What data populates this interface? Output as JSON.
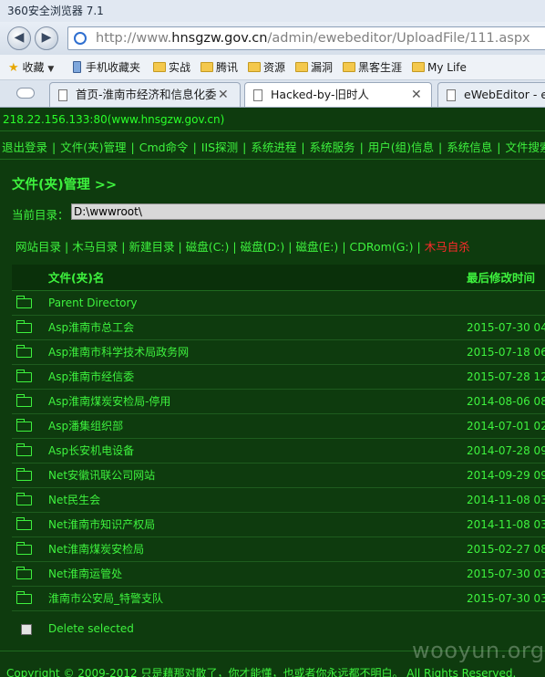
{
  "browser": {
    "window_title": "360安全浏览器 7.1",
    "url_prefix": "http://www.",
    "url_host": "hnsgzw.gov.cn",
    "url_path": "/admin/ewebeditor/UploadFile/111.aspx",
    "favorites": [
      {
        "label": "收藏",
        "icon": "star-icon"
      },
      {
        "label": "手机收藏夹",
        "icon": "phone-icon"
      },
      {
        "label": "实战",
        "icon": "folder-icon"
      },
      {
        "label": "腾讯",
        "icon": "folder-icon"
      },
      {
        "label": "资源",
        "icon": "folder-icon"
      },
      {
        "label": "漏洞",
        "icon": "folder-icon"
      },
      {
        "label": "黑客生涯",
        "icon": "folder-icon"
      },
      {
        "label": "My Life",
        "icon": "folder-icon"
      }
    ],
    "tabs": [
      {
        "title": "首页-淮南市经济和信息化委",
        "close": "✕",
        "active": false
      },
      {
        "title": "Hacked-by-旧时人",
        "close": "✕",
        "active": true
      },
      {
        "title": "eWebEditor - e",
        "close": "",
        "active": false
      }
    ]
  },
  "page": {
    "ip_line": "218.22.156.133:80(www.hnsgzw.gov.cn)",
    "menu": [
      "退出登录",
      "文件(夹)管理",
      "Cmd命令",
      "IIS探测",
      "系统进程",
      "系统服务",
      "用户(组)信息",
      "系统信息",
      "文件搜索"
    ],
    "section_title": "文件(夹)管理  >>",
    "current_dir_label": "当前目录：",
    "current_dir_value": "D:\\wwwroot\\",
    "drives": [
      "网站目录",
      "木马目录",
      "新建目录",
      "磁盘(C:)",
      "磁盘(D:)",
      "磁盘(E:)",
      "CDRom(G:)",
      "木马自杀"
    ],
    "table": {
      "col_name": "文件(夹)名",
      "col_mtime": "最后修改时间",
      "rows": [
        {
          "name": "Parent Directory",
          "mtime": ""
        },
        {
          "name": "Asp淮南市总工会",
          "mtime": "2015-07-30 04:"
        },
        {
          "name": "Asp淮南市科学技术局政务网",
          "mtime": "2015-07-18 06:"
        },
        {
          "name": "Asp淮南市经信委",
          "mtime": "2015-07-28 12:"
        },
        {
          "name": "Asp淮南煤炭安检局-停用",
          "mtime": "2014-08-06 08:"
        },
        {
          "name": "Asp潘集组织部",
          "mtime": "2014-07-01 02:"
        },
        {
          "name": "Asp长安机电设备",
          "mtime": "2014-07-28 09:"
        },
        {
          "name": "Net安徽讯联公司网站",
          "mtime": "2014-09-29 09:"
        },
        {
          "name": "Net民生会",
          "mtime": "2014-11-08 03:"
        },
        {
          "name": "Net淮南市知识产权局",
          "mtime": "2014-11-08 03:"
        },
        {
          "name": "Net淮南煤炭安检局",
          "mtime": "2015-02-27 08:"
        },
        {
          "name": "Net淮南运管处",
          "mtime": "2015-07-30 03:"
        },
        {
          "name": "淮南市公安局_特警支队",
          "mtime": "2015-07-30 03:"
        }
      ],
      "delete_label": "Delete selected"
    },
    "footer": "Copyright © 2009-2012 只是藉那对散了，你才能懂，也或者你永远都不明白。 All Rights Reserved.",
    "watermark": "wooyun.org"
  }
}
